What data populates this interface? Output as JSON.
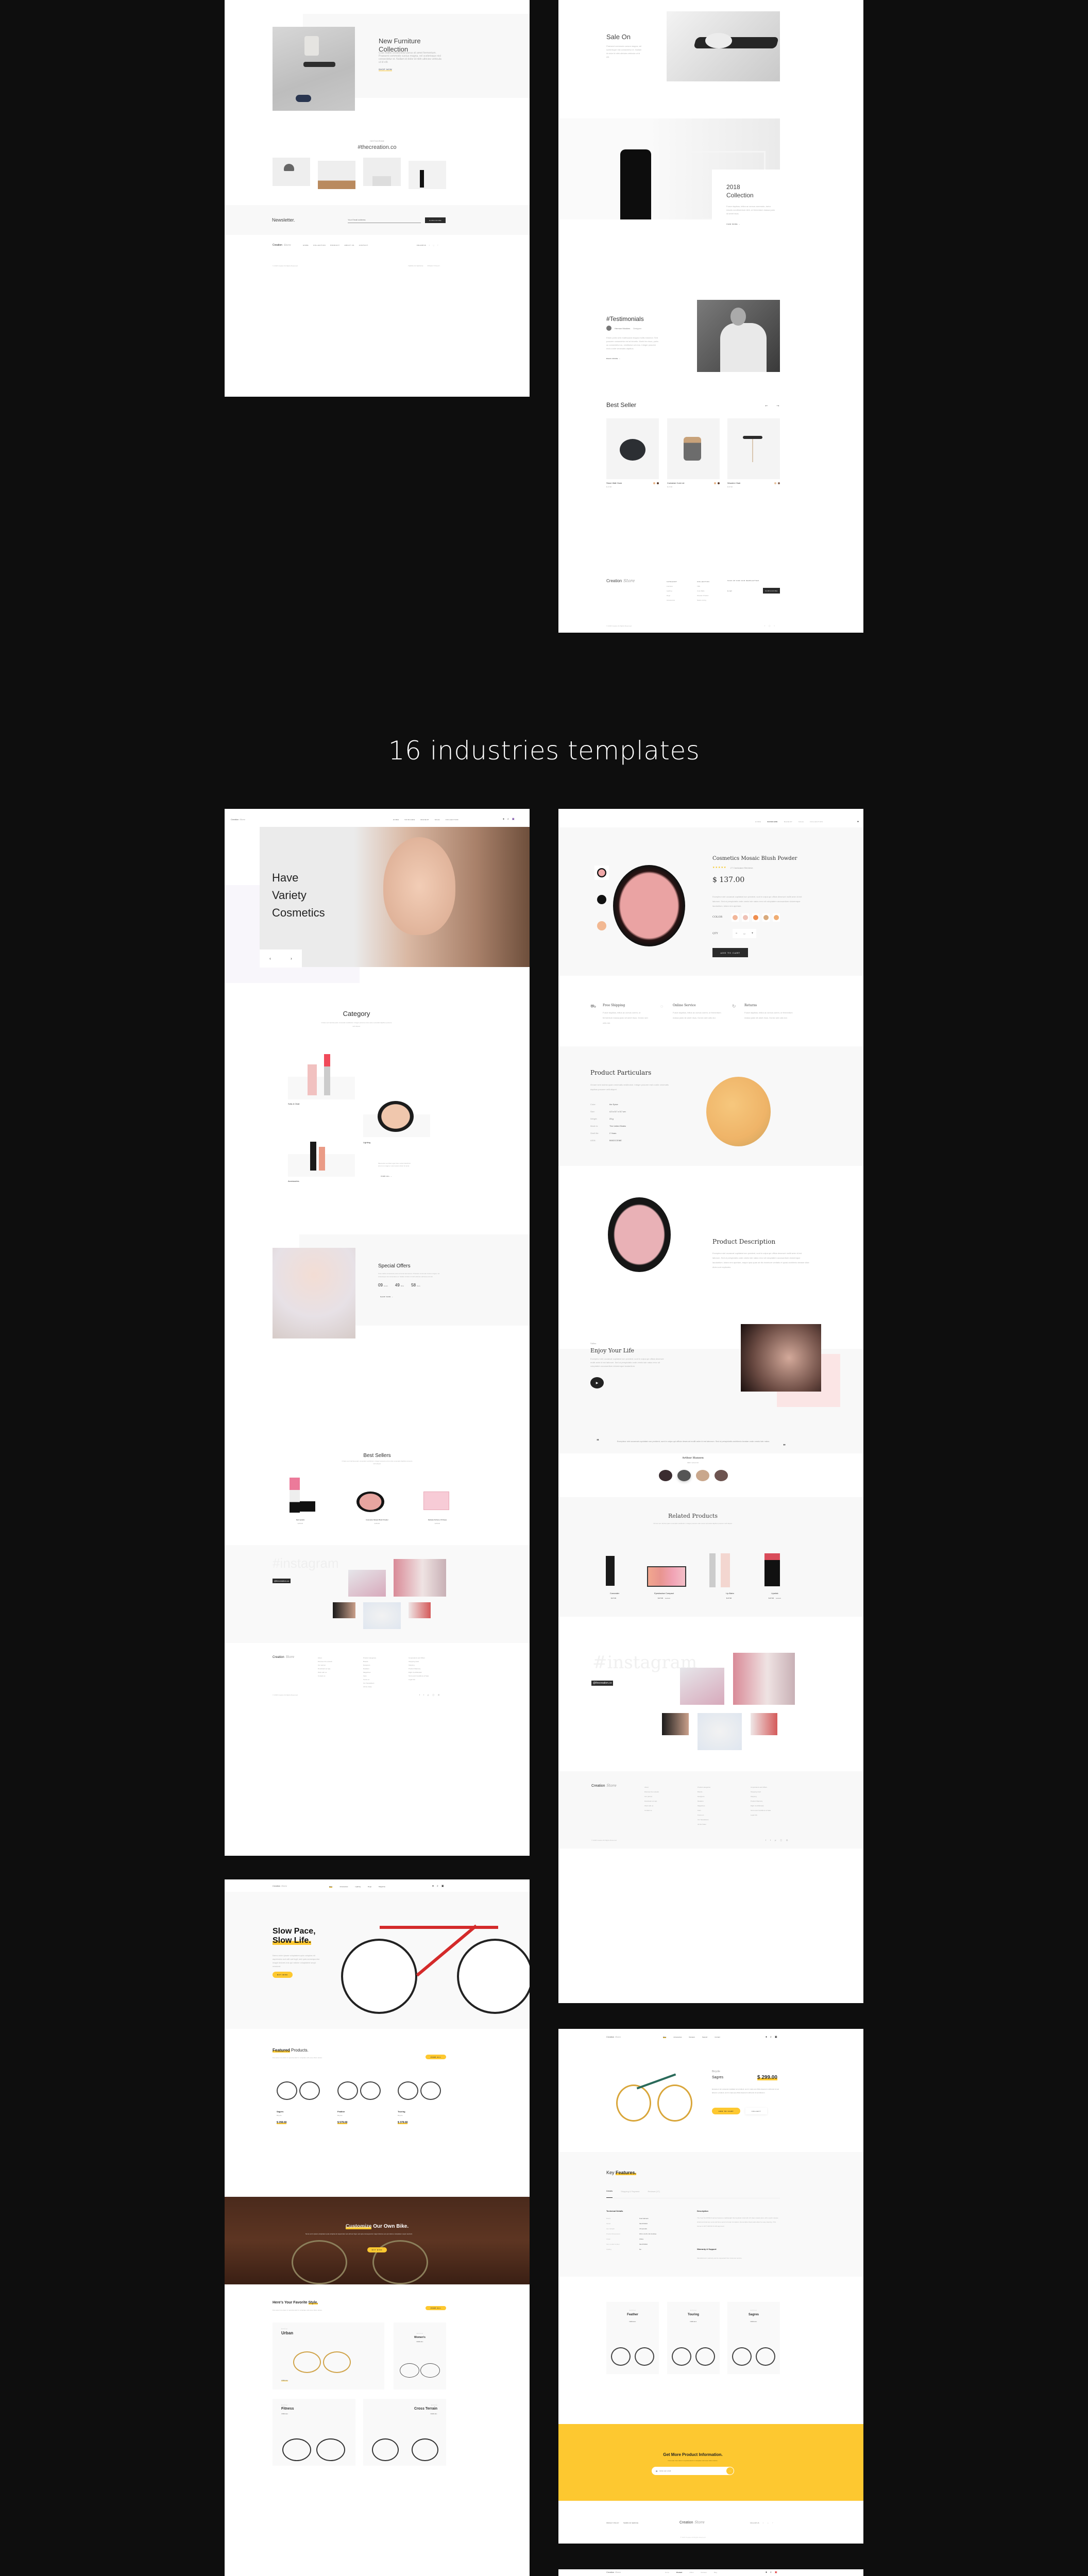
{
  "section_heading": "16 industries templates",
  "furniture_home": {
    "hero": {
      "title_line1": "New Furniture",
      "title_line2": "Collection",
      "body": "Cras mattis consectetur purus sit amet fermentum. Praesent commodo cursus magna, vel scelerisque nisl consectetur et. Nullam id dolor id nibh ultricies vehicula ut id elit.",
      "cta": "Shop Now"
    },
    "instagram": {
      "kicker": "Instagram",
      "title": "#thecreation.co"
    },
    "newsletter": {
      "title": "Newsletter.",
      "placeholder": "Your Email address",
      "button": "Subscribe"
    },
    "footer": {
      "brand": "Creation",
      "brand_script": "Store",
      "nav": [
        "Home",
        "Collection",
        "Product",
        "About Us",
        "Contact"
      ],
      "follow": "Follow Us",
      "copyright": "© 2018 Creation All Rights Reserved",
      "links": [
        "Terms of Service",
        "Privacy Policy"
      ]
    }
  },
  "furniture_collection": {
    "sale": {
      "title": "Sale On",
      "body": "Praesent commodo cursus magna, vel scelerisque nisl consectetur et. Nullam id dolor id nibh ultricies vehicula ut id elit."
    },
    "collection": {
      "title_line1": "2018",
      "title_line2": "Collection",
      "body": "Fusce dapibus, tellus ac cursus commodo, tortor mauris condimentum nibh, ut fermentum massa justo sit amet risus.",
      "cta": "View More"
    },
    "testimonials": {
      "title": "#Testimonials",
      "author": "Hermon Mookins",
      "role": "Designer",
      "body": "Etiam porta sem malesuada magna mollis euismod. Sed posuere consectetur est at lobortis. Morbi leo risus, porta ac consectetur ac, vestibulum at eros. Integer posuere erat a ante venenatis dapibus.",
      "cta": "Read More"
    },
    "best_seller": {
      "title": "Best Seller",
      "prev": "←",
      "next": "→",
      "products": [
        {
          "name": "Stone Wall Clock",
          "price": "$ 17.00",
          "swatches": [
            "#e8b58a",
            "#5a3a2a"
          ]
        },
        {
          "name": "Container Cork Lid",
          "price": "$ 17.00",
          "swatches": [
            "#e8b58a",
            "#5a3a2a"
          ]
        },
        {
          "name": "Wooden Chair",
          "price": "$ 37.00",
          "swatches": [
            "#e8c3a0",
            "#8a6a5a"
          ]
        }
      ]
    },
    "footer": {
      "brand": "Creation",
      "brand_script": "Store",
      "columns": [
        {
          "title": "Category",
          "items": [
            "Furniture",
            "Lighting",
            "Rugs",
            "Accessories"
          ]
        },
        {
          "title": "Collection",
          "items": [
            "TBS",
            "Cole Wallo",
            "Wooden Product",
            "Nature Living"
          ]
        }
      ],
      "newsletter_title": "Sign up for our newsletter",
      "email_placeholder": "E-mail",
      "subscribe": "Subscribe",
      "copyright": "© 2018 Creation All Rights Reserved"
    }
  },
  "cosmetics_home": {
    "nav": {
      "brand": "Creation",
      "brand_script": "Store",
      "items": [
        "Home",
        "Skincare",
        "Makeup",
        "Sale",
        "Collection"
      ]
    },
    "hero": {
      "line1": "Have",
      "line2": "Variety",
      "line3": "Cosmetics",
      "prev": "‹",
      "next": "›"
    },
    "category": {
      "title": "Category",
      "subtitle": "Ornare sem lacinia quam venenatis vestibulum. Integer posuere erat a ante venenatis dapibus posuere velit aliquet.",
      "items": [
        "Sofa & Chair",
        "Lighting",
        "Accessories"
      ],
      "body": "Maecenas sed diam eget risus varius blandit sit amet non magna. Lorem ipsum dolor sit amet.",
      "cta": "View All"
    },
    "special": {
      "title": "Special Offers",
      "body": "Cras mattis consectetur purus sit amet fermentum. Praesent commodo cursus magna, vel scelerisque nisl consectetur et. Nullam id dolor id nibh ultricies vehicula ut id elit.",
      "countdown": [
        {
          "value": "09",
          "unit": "Hours"
        },
        {
          "value": "49",
          "unit": "Mins"
        },
        {
          "value": "58",
          "unit": "Secs"
        }
      ],
      "cta": "Shop Now"
    },
    "best_sellers": {
      "title": "Best Sellers",
      "subtitle": "Ornare sem lacinia quam venenatis vestibulum. Integer posuere erat a ante venenatis dapibus posuere velit aliquet.",
      "products": [
        {
          "name": "Red Lipstick",
          "price": "$ 69.00"
        },
        {
          "name": "Cosmetics Mosaic Blush Powder",
          "price": "$ 69.00"
        },
        {
          "name": "Delicate Perfume Of Roses",
          "price": "$ 69.00"
        }
      ]
    },
    "instagram": {
      "watermark": "#instagram",
      "handle": "@thecreation.co"
    },
    "footer": {
      "brand": "Creation",
      "brand_script": "Store",
      "columns": [
        [
          "About",
          "Discover the network",
          "Our partner",
          "Download our app",
          "Work with us",
          "Contact us"
        ],
        [
          "Product categories",
          "Brands",
          "Designers",
          "Retailers",
          "Magazines",
          "Fans",
          "Focus on",
          "Our Newsletters",
          "All the Video"
        ],
        [
          "Corporations and Offers",
          "Shopping Card",
          "Shipping",
          "Product Warranty",
          "Right of withdrawal",
          "Terms and Conditions of Sale",
          "Legal info"
        ]
      ],
      "copyright": "© 2018 Creation All Rights Reserved"
    }
  },
  "cosmetics_product": {
    "nav": {
      "items": [
        "Home",
        "Skincare",
        "Makeup",
        "Sale",
        "Collection"
      ],
      "active": "Skincare"
    },
    "product": {
      "title": "Cosmetics Mosaic Blush Powder",
      "rating": 4.5,
      "rating_max": 5,
      "reviews": "27 Customer Reviews",
      "price": "$ 137.00",
      "body": "Excepteur sint occaecat cupidatat non proident, sunt in culpa qui officia deserunt mollit anim id est laborum. Sed ut perspiciatis unde omnis iste natus error sit voluptatem accusantium doloremque laudantium, totam rem aperiam.",
      "color_label": "COLOR",
      "colors": [
        "#f2b79a",
        "#efc2b6",
        "#ef8e4f",
        "#d9aa7c",
        "#f0ad73"
      ],
      "qty_label": "QTY",
      "qty": "02",
      "minus": "−",
      "plus": "+",
      "cta": "Add to Cart"
    },
    "features": [
      {
        "icon": "cart-icon",
        "title": "Free Shipping",
        "body": "Fusce dapibus, tellus ac cursus comm, ut fermentum massa justo sit amet risus. Donec sed odio dui."
      },
      {
        "icon": "chat-icon",
        "title": "Online Service",
        "body": "Fusce dapibus, tellus ac cursus comm, ut fermentum massa justo sit amet risus. Donec sed odio dui."
      },
      {
        "icon": "return-icon",
        "title": "Returns",
        "body": "Fusce dapibus, tellus ac cursus comm, ut fermentum massa justo sit amet risus. Donec sed odio dui."
      }
    ],
    "particulars": {
      "title": "Product Particulars",
      "subtitle": "Ornare sem lacinia quam venenatis vestibulum. Integer posuere erat a ante venenatis dapibus posuere velit aliquet.",
      "rows": [
        {
          "label": "Color:",
          "value": "the Spice"
        },
        {
          "label": "Size:",
          "value": "4.3 x 5.7 x 5.7 cm"
        },
        {
          "label": "Weight:",
          "value": "23 g"
        },
        {
          "label": "Made in:",
          "value": "The United States"
        },
        {
          "label": "Shelf life:",
          "value": "2 Years"
        },
        {
          "label": "ASIN:",
          "value": "B002CCEI6E"
        }
      ]
    },
    "description": {
      "title": "Product Description",
      "body": "Excepteur sint occaecat cupidatat non proident, sunt in culpa qui officia deserunt mollit anim id est laborum. Sed ut perspiciatis unde omnis iste natus error sit voluptatem accusantium doloremque laudantium, totam rem aperiam, eaque ipsa quae ab illo inventore veritatis et quasi architecto beatae vitae dicta sunt explicabo."
    },
    "video": {
      "kicker": "Video",
      "title": "Enjoy Your Life",
      "body": "Excepteur sint occaecat cupidatat non proident, sunt in culpa qui officia deserunt mollit anim id est laborum. Sed ut perspiciatis unde omnis iste natus error sit voluptatem accusantium doloremque laudantium."
    },
    "testimonial": {
      "quote": "Excepteur sint occaecat cupidatat non proident, sunt in culpa qui officia deserunt mollit anim id est laborum. Sed ut perspiciatis architecto beatae unde omnis iste natus.",
      "name": "Arthur Hansen",
      "role": "CEO / Lorem Inc"
    },
    "related": {
      "title": "Related Products",
      "subtitle": "Ornare sem lacinia quam venenatis vestibulum. Integer posuere erat a ante venenatis dapibus posuere velit aliquet.",
      "products": [
        {
          "name": "Concealer",
          "price": "$ 27.00",
          "old_price": ""
        },
        {
          "name": "Eyeshadow Compact",
          "price": "$ 27.00",
          "old_price": "$ 29.00"
        },
        {
          "name": "Lip Balm",
          "price": "$ 27.00",
          "old_price": ""
        },
        {
          "name": "Lipstick",
          "price": "$ 27.00",
          "old_price": "$ 49.00"
        }
      ]
    },
    "instagram": {
      "watermark": "#instagram",
      "handle": "@thecreation.co"
    },
    "footer": {
      "brand": "Creation",
      "brand_script": "Store",
      "copyright": "© 2018 Creation All Rights Reserved"
    }
  },
  "bike_home": {
    "nav": {
      "brand": "Creation",
      "brand_script": "Store",
      "items": [
        "Bike",
        "Accessories",
        "Lighting",
        "Rugs",
        "Magazine"
      ],
      "active": "Bike"
    },
    "hero": {
      "line1": "Slow Pace,",
      "line2": "Slow Life.",
      "body": "Nemo enim ipsam voluptatem quia voluptas sit aspernatur aut odit aut fugit, sed quia consequuntur magni dolores eos qui ratione voluptatem sequi nesciunt.",
      "cta": "Buy Bike"
    },
    "featured": {
      "title_hl": "Featured",
      "title_rest": " Products.",
      "subtitle": "Duis aute irure dolor in reprehenderit in voluptate velit esse cillum dolore.",
      "cta": "View All",
      "products": [
        {
          "name": "Sagres",
          "type": "Bicycle",
          "price": "$ 299.00"
        },
        {
          "name": "Feather",
          "type": "Bicycle",
          "price": "$ 579.00"
        },
        {
          "name": "Touring",
          "type": "Bicycle",
          "price": "$ 379.00"
        }
      ]
    },
    "banner": {
      "title_hl": "Customize",
      "title_rest": " Our Own Bike.",
      "body": "Nemo enim ipsam voluptatem quia voluptas sit aspernatur aut odit aut fugit, sed quia consequuntur magni dolores eos qui ratione voluptatem sequi nesciunt.",
      "cta": "Buy Bike"
    },
    "styles": {
      "title_rest": "Here's Your Favorite ",
      "title_hl": "Style.",
      "subtitle": "Duis aute irure dolor in reprehenderit in voluptate velit esse cillum dolore.",
      "cta": "View All",
      "cards": [
        {
          "kicker": "Bicycle",
          "name": "Urban",
          "cta": "View All"
        },
        {
          "kicker": "Bicycle",
          "name": "Women's",
          "cta": "View All"
        },
        {
          "kicker": "Bicycle",
          "name": "Fitness",
          "cta": "View All"
        },
        {
          "kicker": "Bicycle",
          "name": "Cross Terrain",
          "cta": "View All"
        }
      ]
    }
  },
  "bike_product": {
    "nav": {
      "brand": "Creation",
      "brand_script": "Store",
      "items": [
        "Bike",
        "Accessories",
        "Reviews",
        "Support",
        "Contact"
      ],
      "active": "Bike"
    },
    "product": {
      "kicker": "Bicycle",
      "name": "Sagres",
      "price": "$ 299.00",
      "body": "Excepteur sint occaecat cupidatat non proident, sunt in culpa qui officia deserunt mollit anim id est laborum. proident, sunt in culpa qui officia deserunt mollit anim id est laborum.",
      "cta": "Add to Cart",
      "collect": "Collect"
    },
    "features": {
      "title_rest": "Key ",
      "title_hl": "Features.",
      "tabs": [
        "Details",
        "Shipping & Payment",
        "Reviews (17)"
      ],
      "active_tab": "Details",
      "tech_title": "Technical Details",
      "tech_rows": [
        {
          "label": "Brand",
          "value": "Fuel Helmets"
        },
        {
          "label": "Model",
          "value": "SH-FFS014"
        },
        {
          "label": "Item Weight",
          "value": "4.9 pounds"
        },
        {
          "label": "Product Dimensions",
          "value": "15.6 x 11.8 x 10.4 inches"
        },
        {
          "label": "Origin",
          "value": "China"
        },
        {
          "label": "Item model number",
          "value": "SH-FFS014"
        },
        {
          "label": "Folding",
          "value": "No"
        }
      ],
      "desc_title": "Description",
      "desc_body": "The Fuel SH-FFS014 Helmet features a lightweight thermoplastic shell with UV clear-coated paint, with a quick release shield and dual top vents and brow vents for better circulation. Removable cheek pads allow for easy cleaning. This helmet is DOT FMVSS N.218 approved.",
      "warranty_title": "Warranty & Support",
      "warranty_body": "Manufacturer's warranty can be requested from customer service."
    },
    "styles": {
      "title_rest": "Here's Your Favorite ",
      "title_hl": "Style.",
      "subtitle": "Duis aute irure dolor in reprehenderit in voluptate velit esse cillum dolore.",
      "cards": [
        {
          "kicker": "Bicycle",
          "name": "Feather",
          "cta": "View All"
        },
        {
          "kicker": "Bicycle",
          "name": "Touring",
          "cta": "View All"
        },
        {
          "kicker": "Bicycle",
          "name": "Sagres",
          "cta": "View All"
        }
      ]
    },
    "cta_band": {
      "title": "Get More Product Information.",
      "subtitle": "Duis aute irure dolor in reprehenderit in voluptate velit esse cillum dolore.",
      "placeholder": "Enter your email"
    },
    "footer": {
      "links": [
        "Privacy Policy",
        "Terms of Service"
      ],
      "brand": "Creation",
      "brand_script": "Store",
      "follow": "Follow Us",
      "copyright": "© 2018 Creation All Rights Reserved"
    }
  },
  "bike_next": {
    "nav": {
      "brand": "Creation",
      "brand_script": "Store",
      "items": [
        "Home",
        "Product",
        "Offers",
        "Reviews",
        "Blog"
      ],
      "active": "Product"
    }
  },
  "colors": {
    "accent_yellow": "#fdc830",
    "dark": "#2b2b2b",
    "background": "#0e0e0e",
    "panel_gray": "#f8f8f8",
    "star": "#f5c518"
  }
}
